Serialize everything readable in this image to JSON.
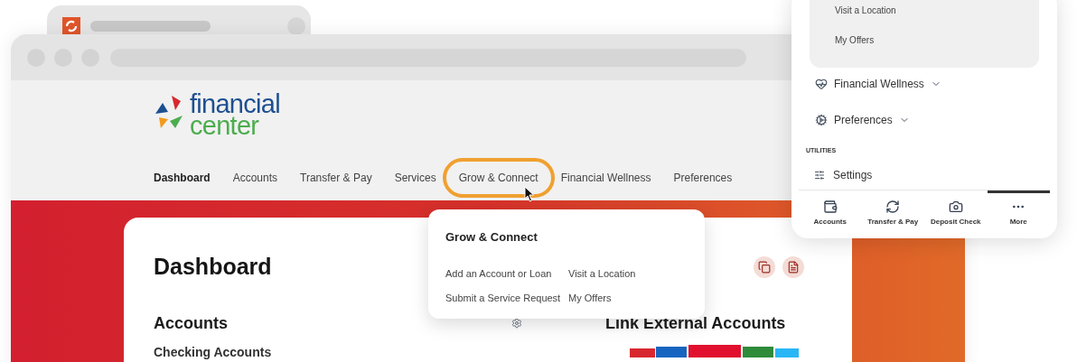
{
  "logo": {
    "line_1": "financial",
    "line_2": "center"
  },
  "nav": [
    {
      "label": "Dashboard",
      "selected": true,
      "highlighted": false
    },
    {
      "label": "Accounts",
      "selected": false,
      "highlighted": false
    },
    {
      "label": "Transfer & Pay",
      "selected": false,
      "highlighted": false
    },
    {
      "label": "Services",
      "selected": false,
      "highlighted": false
    },
    {
      "label": "Grow & Connect",
      "selected": false,
      "highlighted": true
    },
    {
      "label": "Financial Wellness",
      "selected": false,
      "highlighted": false
    },
    {
      "label": "Preferences",
      "selected": false,
      "highlighted": false
    }
  ],
  "dropdown": {
    "title": "Grow & Connect",
    "items": [
      "Add an Account or Loan",
      "Visit a Location",
      "Submit a Service Request",
      "My Offers"
    ]
  },
  "dashboard": {
    "title": "Dashboard",
    "accounts_heading": "Accounts",
    "subheading": "Checking Accounts",
    "link_heading": "Link External Accounts"
  },
  "mobile_menu": {
    "submenu_items": [
      "Visit a Location",
      "My Offers"
    ],
    "sections": [
      {
        "kind": "wellness",
        "label": "Financial Wellness",
        "expanded": false
      },
      {
        "kind": "preferences",
        "label": "Preferences",
        "expanded": false
      }
    ],
    "utilities_label": "UTILITIES",
    "settings": "Settings",
    "tabs": [
      {
        "kind": "accounts",
        "label": "Accounts",
        "selected": false
      },
      {
        "kind": "transfer",
        "label": "Transfer & Pay",
        "selected": false
      },
      {
        "kind": "deposit",
        "label": "Deposit Check",
        "selected": false
      },
      {
        "kind": "more",
        "label": "More",
        "selected": true
      }
    ]
  }
}
